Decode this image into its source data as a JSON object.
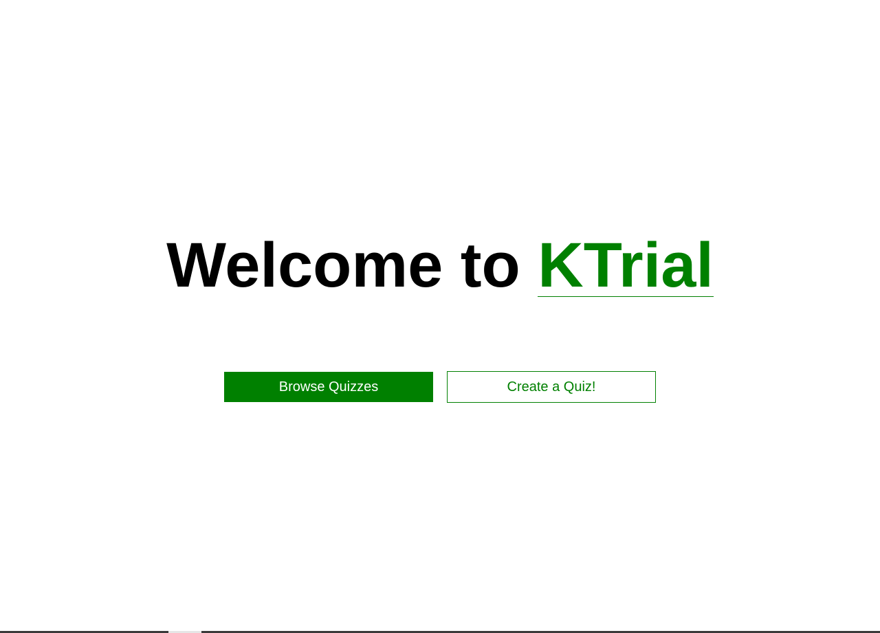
{
  "hero": {
    "prefix": "Welcome to ",
    "brand": "KTrial"
  },
  "actions": {
    "browse_label": "Browse Quizzes",
    "create_label": "Create a Quiz!"
  },
  "colors": {
    "brand": "#008000",
    "text": "#000000",
    "background": "#ffffff"
  }
}
